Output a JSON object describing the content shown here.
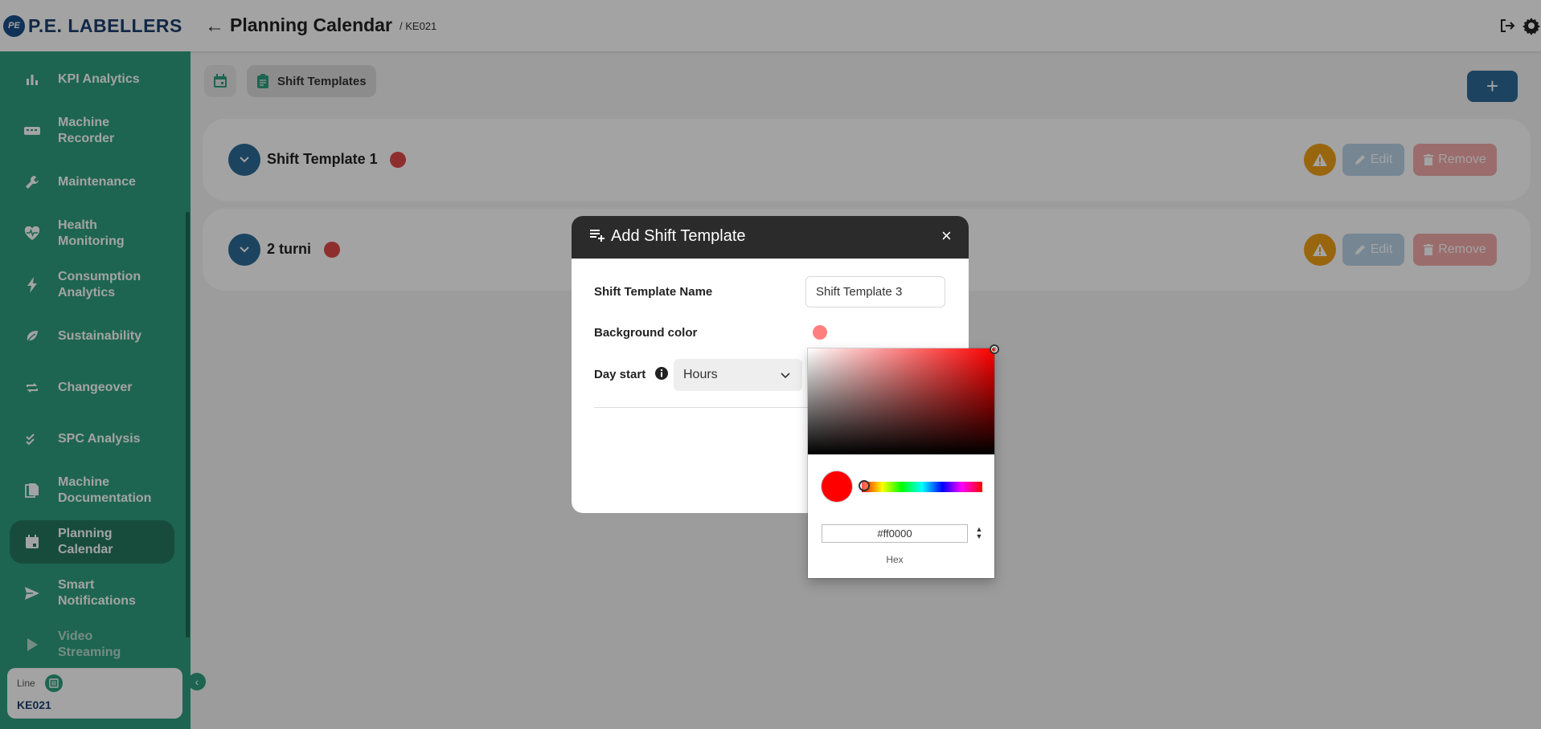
{
  "header": {
    "logo_badge": "PE",
    "logo_text": "P.E. LABELLERS",
    "title": "Planning Calendar",
    "subtitle": "/ KE021"
  },
  "sidebar": {
    "items": [
      {
        "label": "KPI Analytics",
        "icon": "bar-chart-icon"
      },
      {
        "label": "Machine\nRecorder",
        "icon": "recorder-icon"
      },
      {
        "label": "Maintenance",
        "icon": "wrench-icon"
      },
      {
        "label": "Health\nMonitoring",
        "icon": "heart-pulse-icon"
      },
      {
        "label": "Consumption\nAnalytics",
        "icon": "lightning-icon"
      },
      {
        "label": "Sustainability",
        "icon": "leaf-icon"
      },
      {
        "label": "Changeover",
        "icon": "repeat-icon"
      },
      {
        "label": "SPC Analysis",
        "icon": "double-check-icon"
      },
      {
        "label": "Machine\nDocumentation",
        "icon": "documents-icon"
      },
      {
        "label": "Planning\nCalendar",
        "icon": "calendar-icon",
        "active": true
      },
      {
        "label": "Smart\nNotifications",
        "icon": "send-icon"
      },
      {
        "label": "Video\nStreaming",
        "icon": "play-icon",
        "disabled": true
      }
    ],
    "line_label": "Line",
    "line_value": "KE021"
  },
  "tabs": {
    "templates_label": "Shift Templates"
  },
  "add_button": "+",
  "templates": [
    {
      "name": "Shift Template 1",
      "color": "#e04848"
    },
    {
      "name": "2 turni",
      "color": "#e04848"
    }
  ],
  "template_actions": {
    "edit": "Edit",
    "remove": "Remove"
  },
  "modal": {
    "title": "Add Shift Template",
    "close": "×",
    "name_label": "Shift Template Name",
    "name_value": "Shift Template 3",
    "bg_label": "Background color",
    "bg_color": "#ff7f7f",
    "day_start_label": "Day start",
    "day_start_value": "Hours"
  },
  "color_picker": {
    "hex_value": "#ff0000",
    "format_label": "Hex",
    "toggle": "▲▼"
  },
  "colors": {
    "sidebar": "#2e9e7e",
    "primary": "#2c6b96",
    "warning": "#f0a01a",
    "danger": "#e04848"
  }
}
